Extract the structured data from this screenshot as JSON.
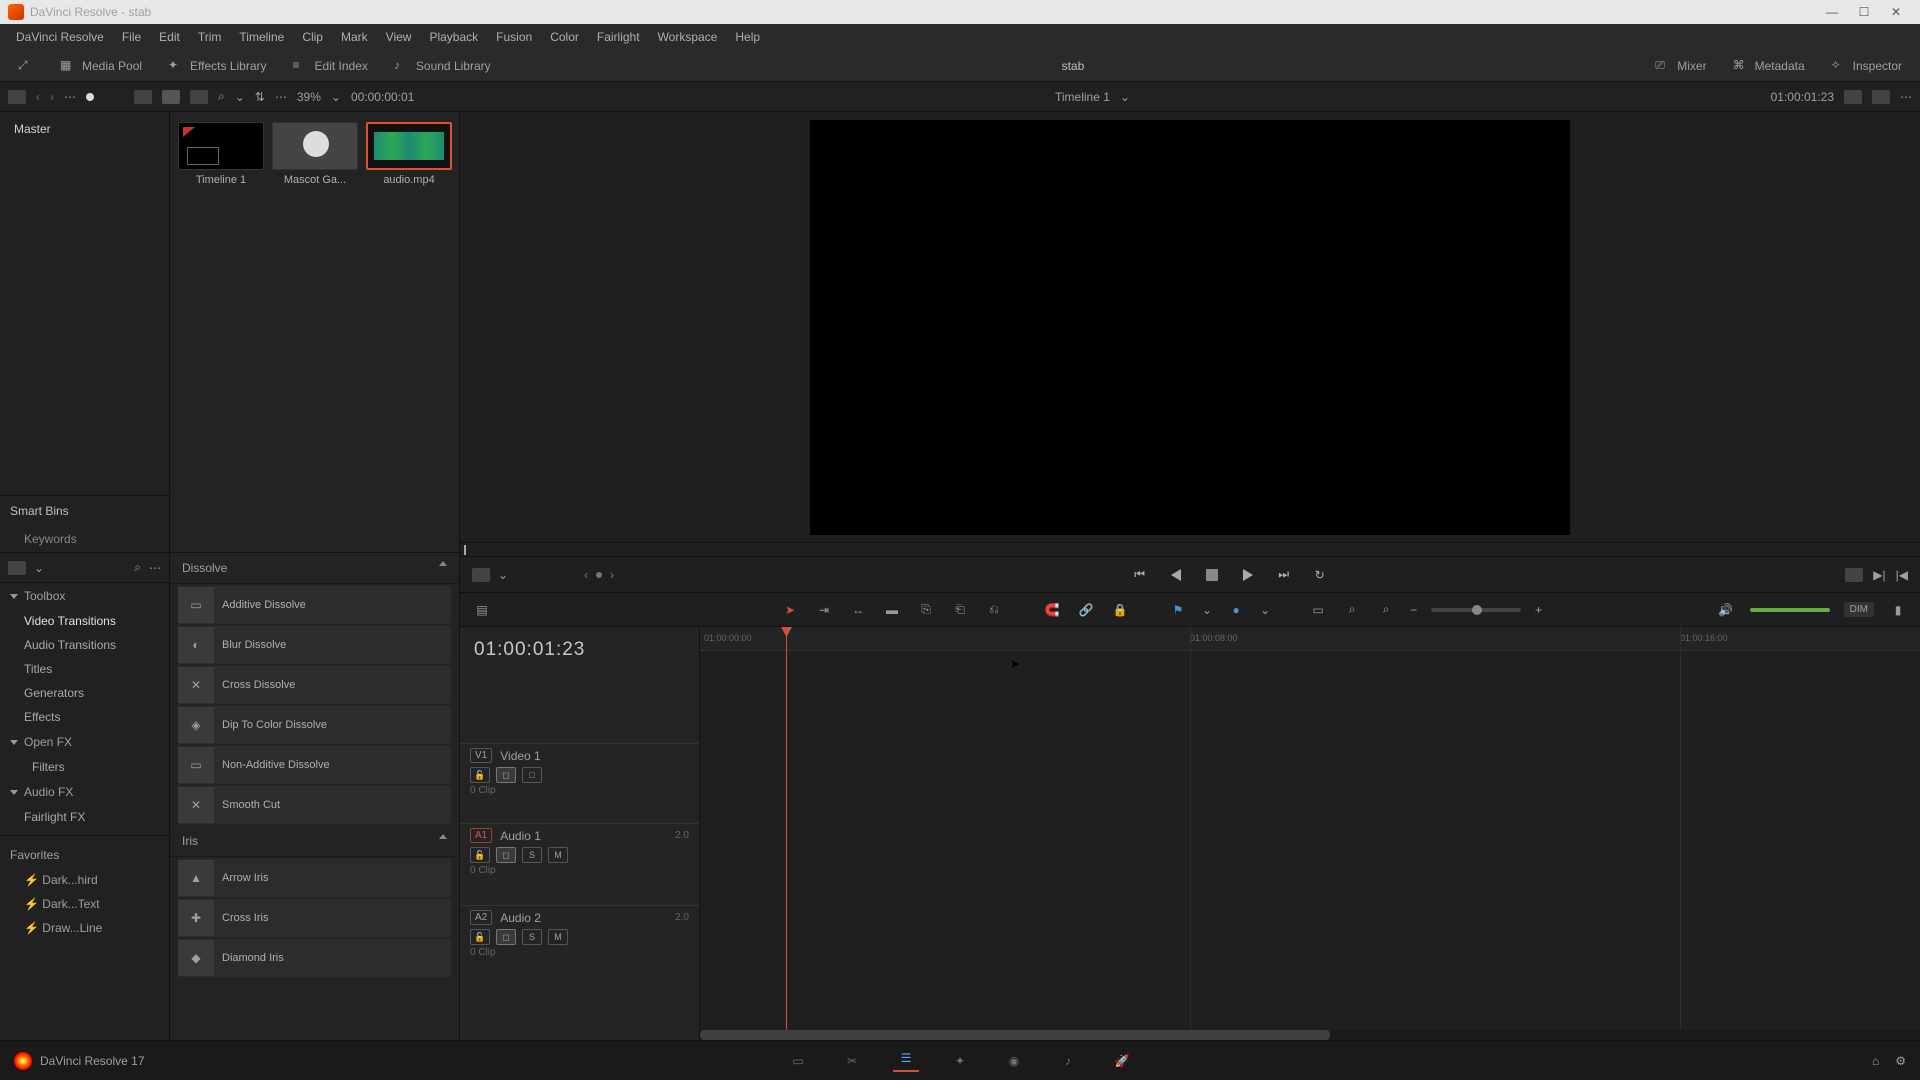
{
  "window": {
    "title": "DaVinci Resolve - stab"
  },
  "menu": [
    "DaVinci Resolve",
    "File",
    "Edit",
    "Trim",
    "Timeline",
    "Clip",
    "Mark",
    "View",
    "Playback",
    "Fusion",
    "Color",
    "Fairlight",
    "Workspace",
    "Help"
  ],
  "top_toggles": {
    "media_pool": "Media Pool",
    "effects_lib": "Effects Library",
    "edit_index": "Edit Index",
    "sound_lib": "Sound Library",
    "project_title": "stab",
    "mixer": "Mixer",
    "metadata": "Metadata",
    "inspector": "Inspector"
  },
  "sec": {
    "zoom_pct": "39%",
    "source_tc": "00:00:00:01",
    "timeline_name": "Timeline 1",
    "record_tc": "01:00:01:23"
  },
  "media": {
    "master": "Master",
    "smart_bins": "Smart Bins",
    "keywords": "Keywords",
    "clips": [
      {
        "name": "Timeline 1",
        "kind": "timeline"
      },
      {
        "name": "Mascot Ga...",
        "kind": "person"
      },
      {
        "name": "audio.mp4",
        "kind": "audio",
        "selected": true
      }
    ]
  },
  "fx_tree": {
    "toolbox": "Toolbox",
    "items": [
      "Video Transitions",
      "Audio Transitions",
      "Titles",
      "Generators",
      "Effects"
    ],
    "open_fx": "Open FX",
    "filters": "Filters",
    "audio_fx": "Audio FX",
    "fairlight_fx": "Fairlight FX",
    "favorites": "Favorites",
    "favs": [
      "Dark...hird",
      "Dark...Text",
      "Draw...Line"
    ]
  },
  "fx_list": {
    "group1": "Dissolve",
    "g1_items": [
      "Additive Dissolve",
      "Blur Dissolve",
      "Cross Dissolve",
      "Dip To Color Dissolve",
      "Non-Additive Dissolve",
      "Smooth Cut"
    ],
    "group2": "Iris",
    "g2_items": [
      "Arrow Iris",
      "Cross Iris",
      "Diamond Iris"
    ]
  },
  "timeline": {
    "display_tc": "01:00:01:23",
    "ruler_ticks": [
      "01:00:00:00",
      "01:00:08:00",
      "01:00:16:00"
    ],
    "tracks": [
      {
        "tag": "V1",
        "name": "Video 1",
        "clips": "0 Clip"
      },
      {
        "tag": "A1",
        "name": "Audio 1",
        "ch": "2.0",
        "clips": "0 Clip"
      },
      {
        "tag": "A2",
        "name": "Audio 2",
        "ch": "2.0",
        "clips": "0 Clip"
      }
    ],
    "s": "S",
    "m": "M",
    "dim": "DIM"
  },
  "footer": {
    "version": "DaVinci Resolve 17"
  }
}
